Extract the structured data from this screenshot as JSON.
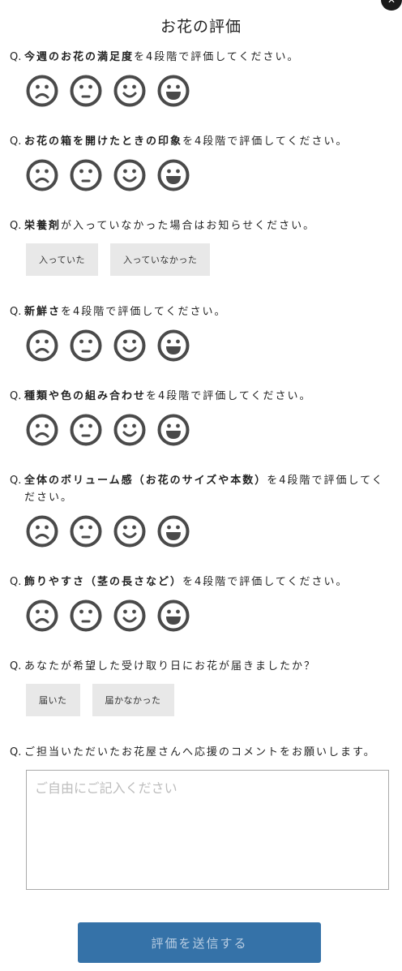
{
  "dialog": {
    "close_glyph": "✕",
    "title": "お花の評価"
  },
  "questions": [
    {
      "prefix": "Q.",
      "bold": "今週のお花の満足度",
      "rest": "を4段階で評価してください。",
      "type": "rating"
    },
    {
      "prefix": "Q.",
      "bold": "お花の箱を開けたときの印象",
      "rest": "を4段階で評価してください。",
      "type": "rating"
    },
    {
      "prefix": "Q.",
      "bold": "栄養剤",
      "rest": "が入っていなかった場合はお知らせください。",
      "type": "choice",
      "options": [
        "入っていた",
        "入っていなかった"
      ]
    },
    {
      "prefix": "Q.",
      "bold": "新鮮さ",
      "rest": "を4段階で評価してください。",
      "type": "rating"
    },
    {
      "prefix": "Q.",
      "bold": "種類や色の組み合わせ",
      "rest": "を4段階で評価してください。",
      "type": "rating"
    },
    {
      "prefix": "Q.",
      "bold": "全体のボリューム感（お花のサイズや本数）",
      "rest": "を4段階で評価してく",
      "rest_line2": "ださい。",
      "type": "rating"
    },
    {
      "prefix": "Q.",
      "bold": "飾りやすさ（茎の長さなど）",
      "rest": "を4段階で評価してください。",
      "type": "rating"
    },
    {
      "prefix": "Q.",
      "bold": "",
      "rest": "あなたが希望した受け取り日にお花が届きましたか？",
      "type": "choice",
      "options": [
        "届いた",
        "届かなかった"
      ]
    },
    {
      "prefix": "Q.",
      "bold": "",
      "rest": "ご担当いただいたお花屋さんへ応援のコメントをお願いします。",
      "type": "text"
    }
  ],
  "rating_icons": [
    "sad-face-icon",
    "neutral-face-icon",
    "smile-face-icon",
    "happy-face-icon"
  ],
  "comment": {
    "placeholder": "ご自由にご記入ください",
    "value": ""
  },
  "submit": {
    "label": "評価を送信する"
  },
  "colors": {
    "face": "#4a4a4a",
    "option_bg": "#e8e8e8",
    "submit_bg": "#3572a8",
    "submit_text": "#b9cde2"
  }
}
